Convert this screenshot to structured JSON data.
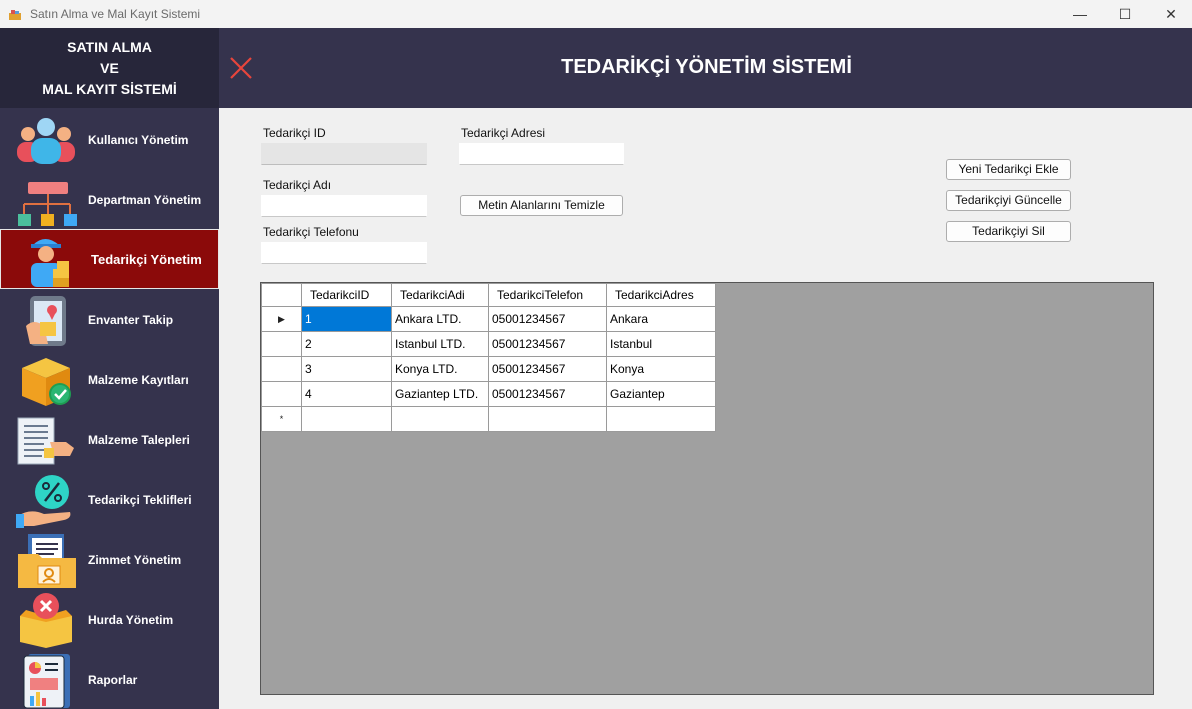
{
  "window": {
    "title": "Satın Alma ve Mal Kayıt Sistemi",
    "minimize_glyph": "—",
    "maximize_glyph": "☐",
    "close_glyph": "✕"
  },
  "sidebar": {
    "brand_line1": "SATIN ALMA",
    "brand_line2": "VE",
    "brand_line3": "MAL KAYIT SİSTEMİ",
    "items": [
      {
        "label": "Kullanıcı Yönetim",
        "icon": "users-icon"
      },
      {
        "label": "Departman Yönetim",
        "icon": "org-chart-icon"
      },
      {
        "label": "Tedarikçi Yönetim",
        "icon": "courier-icon",
        "active": true
      },
      {
        "label": "Envanter Takip",
        "icon": "map-phone-icon"
      },
      {
        "label": "Malzeme Kayıtları",
        "icon": "box-check-icon"
      },
      {
        "label": "Malzeme Talepleri",
        "icon": "document-hand-icon"
      },
      {
        "label": "Tedarikçi Teklifleri",
        "icon": "percent-hand-icon"
      },
      {
        "label": "Zimmet Yönetim",
        "icon": "folder-id-icon"
      },
      {
        "label": "Hurda Yönetim",
        "icon": "box-x-icon"
      },
      {
        "label": "Raporlar",
        "icon": "report-icon"
      }
    ]
  },
  "header": {
    "title": "TEDARİKÇİ YÖNETİM SİSTEMİ",
    "accent": "#e8453c"
  },
  "form": {
    "id_label": "Tedarikçi ID",
    "id_value": "",
    "name_label": "Tedarikçi Adı",
    "name_value": "",
    "phone_label": "Tedarikçi Telefonu",
    "phone_value": "",
    "address_label": "Tedarikçi Adresi",
    "address_value": "",
    "clear_button": "Metin Alanlarını Temizle",
    "add_button": "Yeni Tedarikçi Ekle",
    "update_button": "Tedarikçiyi Güncelle",
    "delete_button": "Tedarikçiyi Sil"
  },
  "grid": {
    "columns": [
      "TedarikciID",
      "TedarikciAdi",
      "TedarikciTelefon",
      "TedarikciAdres"
    ],
    "current_row_glyph": "▶",
    "new_row_glyph": "*",
    "rows": [
      [
        "1",
        "Ankara LTD.",
        "05001234567",
        "Ankara"
      ],
      [
        "2",
        "Istanbul LTD.",
        "05001234567",
        "Istanbul"
      ],
      [
        "3",
        "Konya LTD.",
        "05001234567",
        "Konya"
      ],
      [
        "4",
        "Gaziantep LTD.",
        "05001234567",
        "Gaziantep"
      ]
    ],
    "selection_color": "#0078d7"
  },
  "colors": {
    "sidebar_bg": "#35334d",
    "brand_bg": "#27263a",
    "active_item_bg": "#8b0a0a",
    "grid_bg": "#a0a0a0"
  }
}
